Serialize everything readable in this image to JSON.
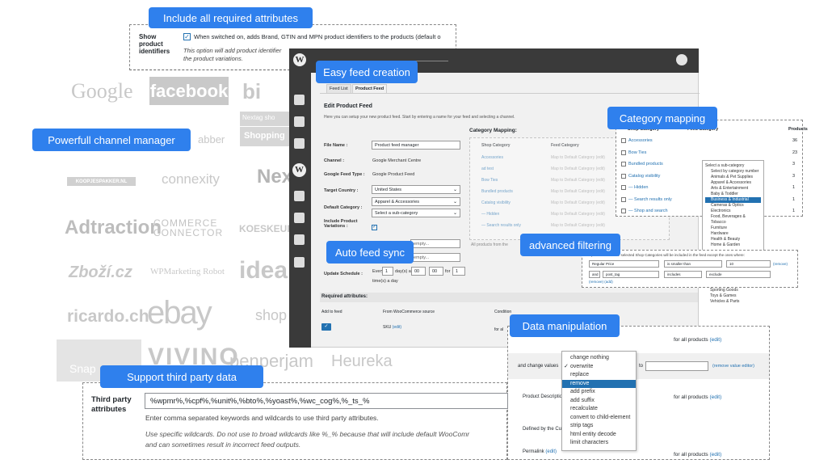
{
  "labels": {
    "required_attributes": "Include all required attributes",
    "channel_manager": "Powerfull channel manager",
    "easy_feed": "Easy feed creation",
    "category_mapping": "Category mapping",
    "auto_feed": "Auto feed sync",
    "advanced_filtering": "advanced filtering",
    "data_manipulation": "Data manipulation",
    "third_party": "Support third party data"
  },
  "show_identifiers": {
    "label": "Show product identifiers",
    "text1": "When switched on, adds Brand, GTIN and MPN product identifiers to the products (default o",
    "text2": "This option will add product identifier",
    "text3": "the product variations."
  },
  "logos": {
    "google": "Google",
    "facebook": "facebook",
    "bing": "bi",
    "nextag": "Nextag sho",
    "shopping": "Shopping",
    "abber": "abber",
    "koopjes": "KOOPJESPAKKER.NL",
    "connexity": "connexity",
    "next": "Next",
    "adtraction": "Adtraction",
    "commerce": "COMMERCE",
    "connector": "CONNECTOR",
    "koeskeuf": "KOESKEUF",
    "zbozi": "Zboží.cz",
    "wpmr": "WPMarketing Robot",
    "idea": "idea",
    "ricardo": "ricardo.ch",
    "ebay": "ebay",
    "shop": "shop",
    "snap": "Snap",
    "vivino": "VIVINO",
    "nenperjam": "penperjam",
    "heureka": "Heureka"
  },
  "wp": {
    "tabs": [
      "Feed List",
      "Product Feed"
    ],
    "title": "Edit Product Feed",
    "intro": "Here you can setup your new product feed. Start by entering a name for your feed and selecting a channel.",
    "file_name_label": "File Name :",
    "file_name": "Product feed manager",
    "channel_label": "Channel :",
    "channel": "Google Merchant Centre",
    "feed_type_label": "Google Feed Type :",
    "feed_type": "Google Product Feed",
    "target_country_label": "Target Country :",
    "target_country": "United States",
    "default_category_label": "Default Category :",
    "default_category": "Apparel & Accessories",
    "sub_category": "Select a sub-category",
    "include_variations_label": "Include Product Variations :",
    "update_label": "Update Schedule :",
    "every": "Every",
    "day_at": "day(s) at",
    "for": "for",
    "time_a_day": "time(s) a day",
    "val1": "1",
    "val2": "00",
    "val3": "00",
    "val4": "1",
    "empty": "empty...",
    "empty2": "empty...",
    "cm_header": "Category Mapping:",
    "cm_shop": "Shop Category",
    "cm_feed": "Feed Category",
    "cm_rows": [
      "Accessories",
      "ad test",
      "Bow Ties",
      "Bundled products",
      "Catalog visibility",
      "— Hidden",
      "— Search results only",
      "— Shop and search"
    ],
    "cm_map": "Map to Default Category (edit)",
    "all_products": "All products from the",
    "required_header": "Required attributes:",
    "add_to_feed": "Add to feed",
    "from_woo": "From WooCommerce source",
    "condition": "Condition",
    "sku": "SKU",
    "edit": "(edit)",
    "for_all": "for al"
  },
  "category_panel": {
    "col1": "Shop Category",
    "col2": "Feed Category",
    "col3": "Products",
    "rows": [
      {
        "name": "Accessories",
        "count": "36"
      },
      {
        "name": "Bow Ties",
        "count": "23"
      },
      {
        "name": "Bundled products",
        "count": "3"
      },
      {
        "name": "Catalog visibility",
        "count": "3"
      },
      {
        "name": "— Hidden",
        "count": "1"
      },
      {
        "name": "— Search results only",
        "count": "1"
      },
      {
        "name": "— Shop and search",
        "count": "1"
      }
    ],
    "feed_sync": "feed (sync)"
  },
  "dropdown": [
    "Select a sub-category",
    "Select by category number",
    "Animals & Pet Supplies",
    "Apparel & Accessories",
    "Arts & Entertainment",
    "Baby & Toddler",
    "Business & Industrial",
    "Cameras & Optics",
    "Electronics",
    "Food, Beverages & Tobacco",
    "Furniture",
    "Hardware",
    "Health & Beauty",
    "Home & Garden"
  ],
  "dropdown_tail": [
    "Sporting Goods",
    "Toys & Games",
    "Vehicles & Parts"
  ],
  "filter": {
    "intro": "All products from the selected Shop Categories will be included in the feed except the ones where:",
    "f1": "Regular Price",
    "f2": "is smaller than",
    "f3": "10",
    "remove": "(remove)",
    "and": "and",
    "a1": "post_tag",
    "a2": "includes",
    "a3": "exclude",
    "links": "(remove) (add)"
  },
  "datamanip": {
    "for_all": "for all products",
    "edit": "(edit)",
    "change_values": "and change values",
    "to": "to",
    "remove_edit": "(remove value editor)",
    "product_desc": "Product Descriptio",
    "for_all2": "for all products",
    "defined_by": "Defined by the Cu",
    "permalink": "Permalink",
    "for_all3": "for all products",
    "options": [
      "change nothing",
      "overwrite",
      "replace",
      "remove",
      "add prefix",
      "add suffix",
      "recalculate",
      "convert to child-element",
      "strip tags",
      "html entity decode",
      "limit characters"
    ],
    "selected": "remove",
    "checked": "overwrite"
  },
  "third": {
    "label": "Third party attributes",
    "value": "%wpmr%,%cpf%,%unit%,%bto%,%yoast%,%wc_cog%,%_ts_%",
    "help": "Enter comma separated keywords and wildcards to use third party attributes.",
    "note1": "Use specific wildcards. Do not use to broad wildcards like %_% because that will include default WooComr",
    "note2": "and can sometimes result in incorrect feed outputs."
  }
}
